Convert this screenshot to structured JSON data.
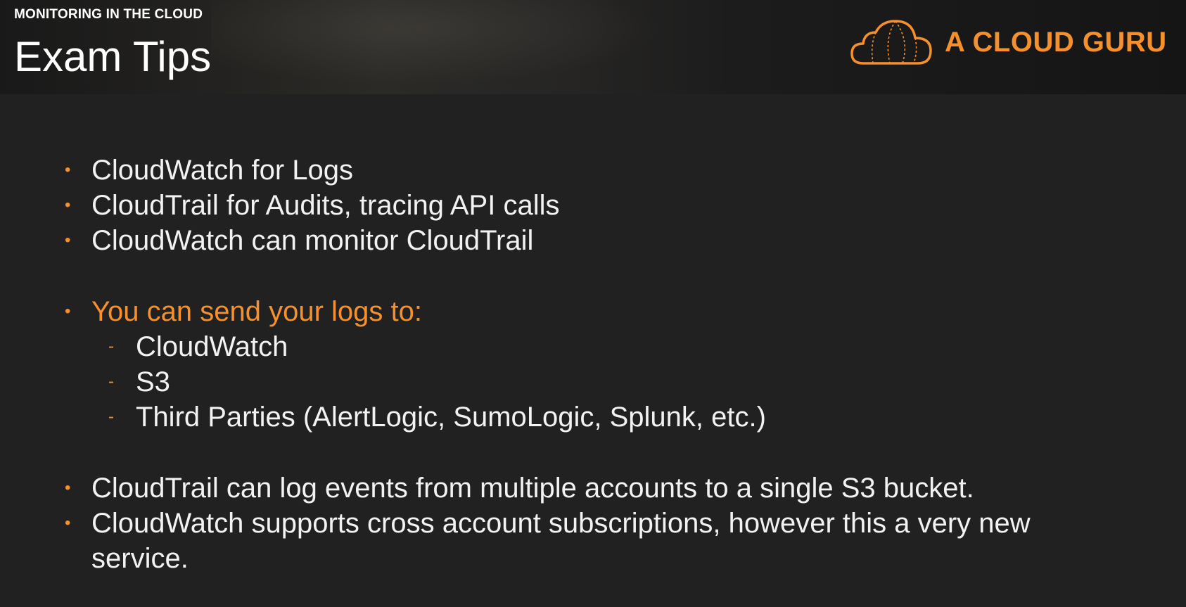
{
  "header": {
    "section_label": "MONITORING IN THE CLOUD",
    "title": "Exam Tips",
    "logo_text": "A CLOUD GURU"
  },
  "colors": {
    "accent": "#f6902c",
    "background": "#212121",
    "text": "#f2f2f2"
  },
  "icons": {
    "bullet": "dot",
    "sub_bullet": "dash",
    "logo": "cloud-icon"
  },
  "bullets_group1": [
    "CloudWatch for Logs",
    "CloudTrail for Audits, tracing API calls",
    "CloudWatch can monitor CloudTrail"
  ],
  "bullets_group2": {
    "heading": "You can send your logs to:",
    "sub_items": [
      "CloudWatch",
      "S3",
      "Third Parties (AlertLogic, SumoLogic, Splunk, etc.)"
    ]
  },
  "bullets_group3": [
    "CloudTrail can log events from multiple accounts to a single S3 bucket.",
    "CloudWatch supports cross account subscriptions, however this a very new",
    "service."
  ]
}
